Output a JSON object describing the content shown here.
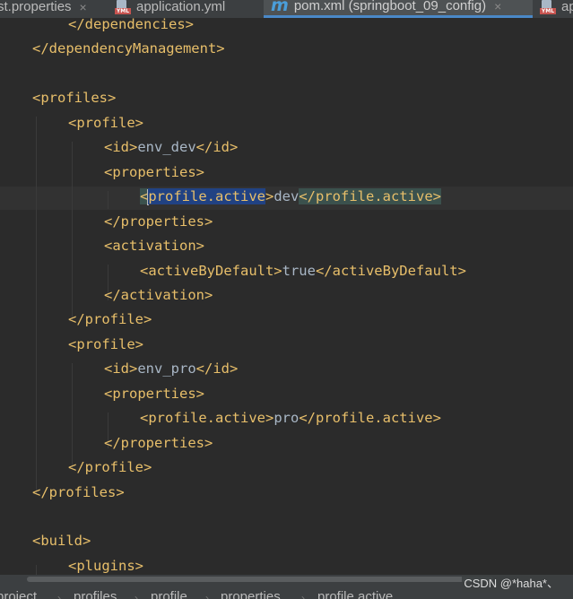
{
  "tabs": [
    {
      "label": "st.properties",
      "icon": "properties-file-icon",
      "active": false
    },
    {
      "label": "application.yml",
      "icon": "yml-file-icon",
      "active": false
    },
    {
      "label": "pom.xml (springboot_09_config)",
      "icon": "maven-m-icon",
      "active": true
    },
    {
      "label": "ap",
      "icon": "yml-file-icon",
      "active": false
    }
  ],
  "tab_close_glyph": "×",
  "yml_badge": "YML",
  "maven_glyph": "m",
  "editor": {
    "lines": [
      {
        "tokens": [
          {
            "t": "tag",
            "v": "</dependencies>"
          }
        ]
      },
      {
        "tokens": [
          {
            "t": "tag",
            "v": "</dependencyManagement>"
          }
        ]
      },
      {
        "tokens": []
      },
      {
        "tokens": [
          {
            "t": "tag",
            "v": "<profiles>"
          }
        ]
      },
      {
        "tokens": [
          {
            "t": "tag",
            "v": "<profile>"
          }
        ]
      },
      {
        "tokens": [
          {
            "t": "tag",
            "v": "<id>"
          },
          {
            "t": "text",
            "v": "env_dev"
          },
          {
            "t": "tag",
            "v": "</id>"
          }
        ]
      },
      {
        "tokens": [
          {
            "t": "tag",
            "v": "<properties>"
          }
        ]
      },
      {
        "tokens": [
          {
            "t": "tag",
            "v": "<"
          },
          {
            "t": "tag",
            "v": "profile.active"
          },
          {
            "t": "tag",
            "v": ">"
          },
          {
            "t": "text",
            "v": "dev"
          },
          {
            "t": "tag",
            "v": "</profile.active>"
          }
        ]
      },
      {
        "tokens": [
          {
            "t": "tag",
            "v": "</properties>"
          }
        ]
      },
      {
        "tokens": [
          {
            "t": "tag",
            "v": "<activation>"
          }
        ]
      },
      {
        "tokens": [
          {
            "t": "tag",
            "v": "<activeByDefault>"
          },
          {
            "t": "text",
            "v": "true"
          },
          {
            "t": "tag",
            "v": "</activeByDefault>"
          }
        ]
      },
      {
        "tokens": [
          {
            "t": "tag",
            "v": "</activation>"
          }
        ]
      },
      {
        "tokens": [
          {
            "t": "tag",
            "v": "</profile>"
          }
        ]
      },
      {
        "tokens": [
          {
            "t": "tag",
            "v": "<profile>"
          }
        ]
      },
      {
        "tokens": [
          {
            "t": "tag",
            "v": "<id>"
          },
          {
            "t": "text",
            "v": "env_pro"
          },
          {
            "t": "tag",
            "v": "</id>"
          }
        ]
      },
      {
        "tokens": [
          {
            "t": "tag",
            "v": "<properties>"
          }
        ]
      },
      {
        "tokens": [
          {
            "t": "tag",
            "v": "<profile.active>"
          },
          {
            "t": "text",
            "v": "pro"
          },
          {
            "t": "tag",
            "v": "</profile.active>"
          }
        ]
      },
      {
        "tokens": [
          {
            "t": "tag",
            "v": "</properties>"
          }
        ]
      },
      {
        "tokens": [
          {
            "t": "tag",
            "v": "</profile>"
          }
        ]
      },
      {
        "tokens": [
          {
            "t": "tag",
            "v": "</profiles>"
          }
        ]
      },
      {
        "tokens": []
      },
      {
        "tokens": [
          {
            "t": "tag",
            "v": "<build>"
          }
        ]
      },
      {
        "tokens": [
          {
            "t": "tag",
            "v": "<plugins>"
          }
        ]
      }
    ]
  },
  "breadcrumb": {
    "items": [
      "project",
      "profiles",
      "profile",
      "properties",
      "profile.active"
    ],
    "separator": "›"
  },
  "watermark": "CSDN @*haha*、",
  "colors": {
    "background": "#2b2b2b",
    "tag": "#e8bf6a",
    "text": "#a9b7c6",
    "selection": "#214283",
    "match_highlight": "#3b514d",
    "active_tab_underline": "#4a88c7"
  }
}
